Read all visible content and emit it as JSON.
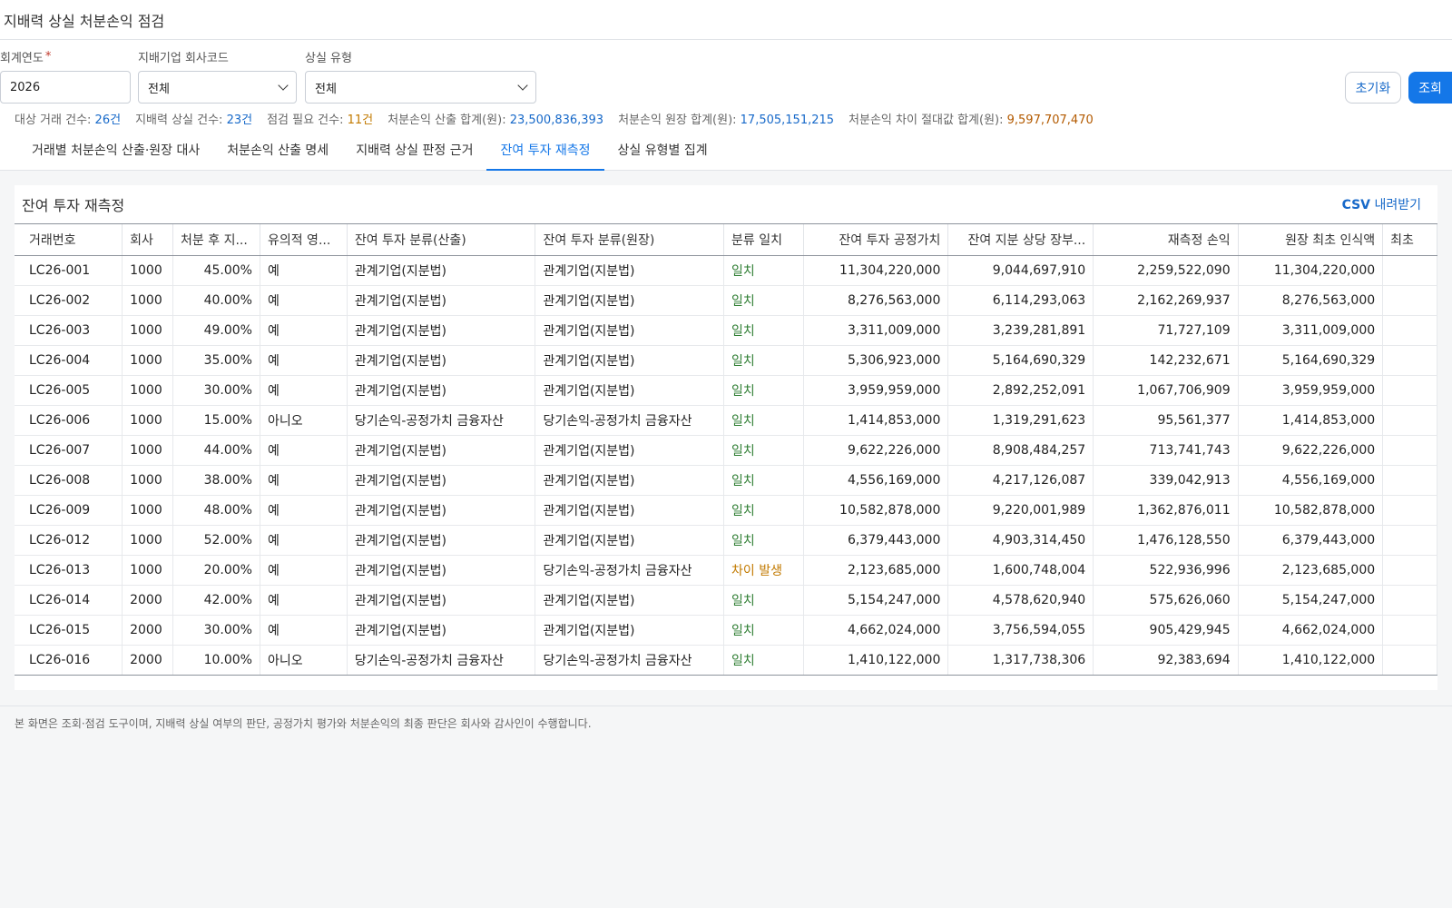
{
  "header": {
    "title": "지배력 상실 처분손익 점검"
  },
  "filters": {
    "year": {
      "label": "회계연도",
      "required_mark": "*",
      "value": "2026"
    },
    "company": {
      "label": "지배기업 회사코드",
      "value": "전체"
    },
    "loss_type": {
      "label": "상실 유형",
      "value": "전체"
    },
    "reset_label": "초기화",
    "search_label": "조회"
  },
  "summary": [
    {
      "label": "대상 거래 건수: ",
      "value": "26건",
      "tone": "blue"
    },
    {
      "label": "지배력 상실 건수: ",
      "value": "23건",
      "tone": "blue"
    },
    {
      "label": "점검 필요 건수: ",
      "value": "11건",
      "tone": "orange"
    },
    {
      "label": "처분손익 산출 합계(원): ",
      "value": "23,500,836,393",
      "tone": "blue"
    },
    {
      "label": "처분손익 원장 합계(원): ",
      "value": "17,505,151,215",
      "tone": "blue"
    },
    {
      "label": "처분손익 차이 절대값 합계(원): ",
      "value": "9,597,707,470",
      "tone": "brown"
    }
  ],
  "tabs": [
    {
      "label": "거래별 처분손익 산출·원장 대사",
      "active": false
    },
    {
      "label": "처분손익 산출 명세",
      "active": false
    },
    {
      "label": "지배력 상실 판정 근거",
      "active": false
    },
    {
      "label": "잔여 투자 재측정",
      "active": true
    },
    {
      "label": "상실 유형별 집계",
      "active": false
    }
  ],
  "panel": {
    "title": "잔여 투자 재측정",
    "csv_strong": "CSV",
    "csv_rest": " 내려받기"
  },
  "table": {
    "columns": [
      "거래번호",
      "회사",
      "처분 후 지...",
      "유의적 영...",
      "잔여 투자 분류(산출)",
      "잔여 투자 분류(원장)",
      "분류 일치",
      "잔여 투자 공정가치",
      "잔여 지분 상당 장부...",
      "재측정 손익",
      "원장 최초 인식액",
      "최초"
    ],
    "rows": [
      [
        "LC26-001",
        "1000",
        "45.00%",
        "예",
        "관계기업(지분법)",
        "관계기업(지분법)",
        "일치",
        "11,304,220,000",
        "9,044,697,910",
        "2,259,522,090",
        "11,304,220,000",
        ""
      ],
      [
        "LC26-002",
        "1000",
        "40.00%",
        "예",
        "관계기업(지분법)",
        "관계기업(지분법)",
        "일치",
        "8,276,563,000",
        "6,114,293,063",
        "2,162,269,937",
        "8,276,563,000",
        ""
      ],
      [
        "LC26-003",
        "1000",
        "49.00%",
        "예",
        "관계기업(지분법)",
        "관계기업(지분법)",
        "일치",
        "3,311,009,000",
        "3,239,281,891",
        "71,727,109",
        "3,311,009,000",
        ""
      ],
      [
        "LC26-004",
        "1000",
        "35.00%",
        "예",
        "관계기업(지분법)",
        "관계기업(지분법)",
        "일치",
        "5,306,923,000",
        "5,164,690,329",
        "142,232,671",
        "5,164,690,329",
        ""
      ],
      [
        "LC26-005",
        "1000",
        "30.00%",
        "예",
        "관계기업(지분법)",
        "관계기업(지분법)",
        "일치",
        "3,959,959,000",
        "2,892,252,091",
        "1,067,706,909",
        "3,959,959,000",
        ""
      ],
      [
        "LC26-006",
        "1000",
        "15.00%",
        "아니오",
        "당기손익-공정가치 금융자산",
        "당기손익-공정가치 금융자산",
        "일치",
        "1,414,853,000",
        "1,319,291,623",
        "95,561,377",
        "1,414,853,000",
        ""
      ],
      [
        "LC26-007",
        "1000",
        "44.00%",
        "예",
        "관계기업(지분법)",
        "관계기업(지분법)",
        "일치",
        "9,622,226,000",
        "8,908,484,257",
        "713,741,743",
        "9,622,226,000",
        ""
      ],
      [
        "LC26-008",
        "1000",
        "38.00%",
        "예",
        "관계기업(지분법)",
        "관계기업(지분법)",
        "일치",
        "4,556,169,000",
        "4,217,126,087",
        "339,042,913",
        "4,556,169,000",
        ""
      ],
      [
        "LC26-009",
        "1000",
        "48.00%",
        "예",
        "관계기업(지분법)",
        "관계기업(지분법)",
        "일치",
        "10,582,878,000",
        "9,220,001,989",
        "1,362,876,011",
        "10,582,878,000",
        ""
      ],
      [
        "LC26-012",
        "1000",
        "52.00%",
        "예",
        "관계기업(지분법)",
        "관계기업(지분법)",
        "일치",
        "6,379,443,000",
        "4,903,314,450",
        "1,476,128,550",
        "6,379,443,000",
        ""
      ],
      [
        "LC26-013",
        "1000",
        "20.00%",
        "예",
        "관계기업(지분법)",
        "당기손익-공정가치 금융자산",
        "차이 발생",
        "2,123,685,000",
        "1,600,748,004",
        "522,936,996",
        "2,123,685,000",
        ""
      ],
      [
        "LC26-014",
        "2000",
        "42.00%",
        "예",
        "관계기업(지분법)",
        "관계기업(지분법)",
        "일치",
        "5,154,247,000",
        "4,578,620,940",
        "575,626,060",
        "5,154,247,000",
        ""
      ],
      [
        "LC26-015",
        "2000",
        "30.00%",
        "예",
        "관계기업(지분법)",
        "관계기업(지분법)",
        "일치",
        "4,662,024,000",
        "3,756,594,055",
        "905,429,945",
        "4,662,024,000",
        ""
      ],
      [
        "LC26-016",
        "2000",
        "10.00%",
        "아니오",
        "당기손익-공정가치 금융자산",
        "당기손익-공정가치 금융자산",
        "일치",
        "1,410,122,000",
        "1,317,738,306",
        "92,383,694",
        "1,410,122,000",
        ""
      ]
    ]
  },
  "footer": {
    "note": "본 화면은 조회·점검 도구이며, 지배력 상실 여부의 판단, 공정가치 평가와 처분손익의 최종 판단은 회사와 감사인이 수행합니다."
  }
}
